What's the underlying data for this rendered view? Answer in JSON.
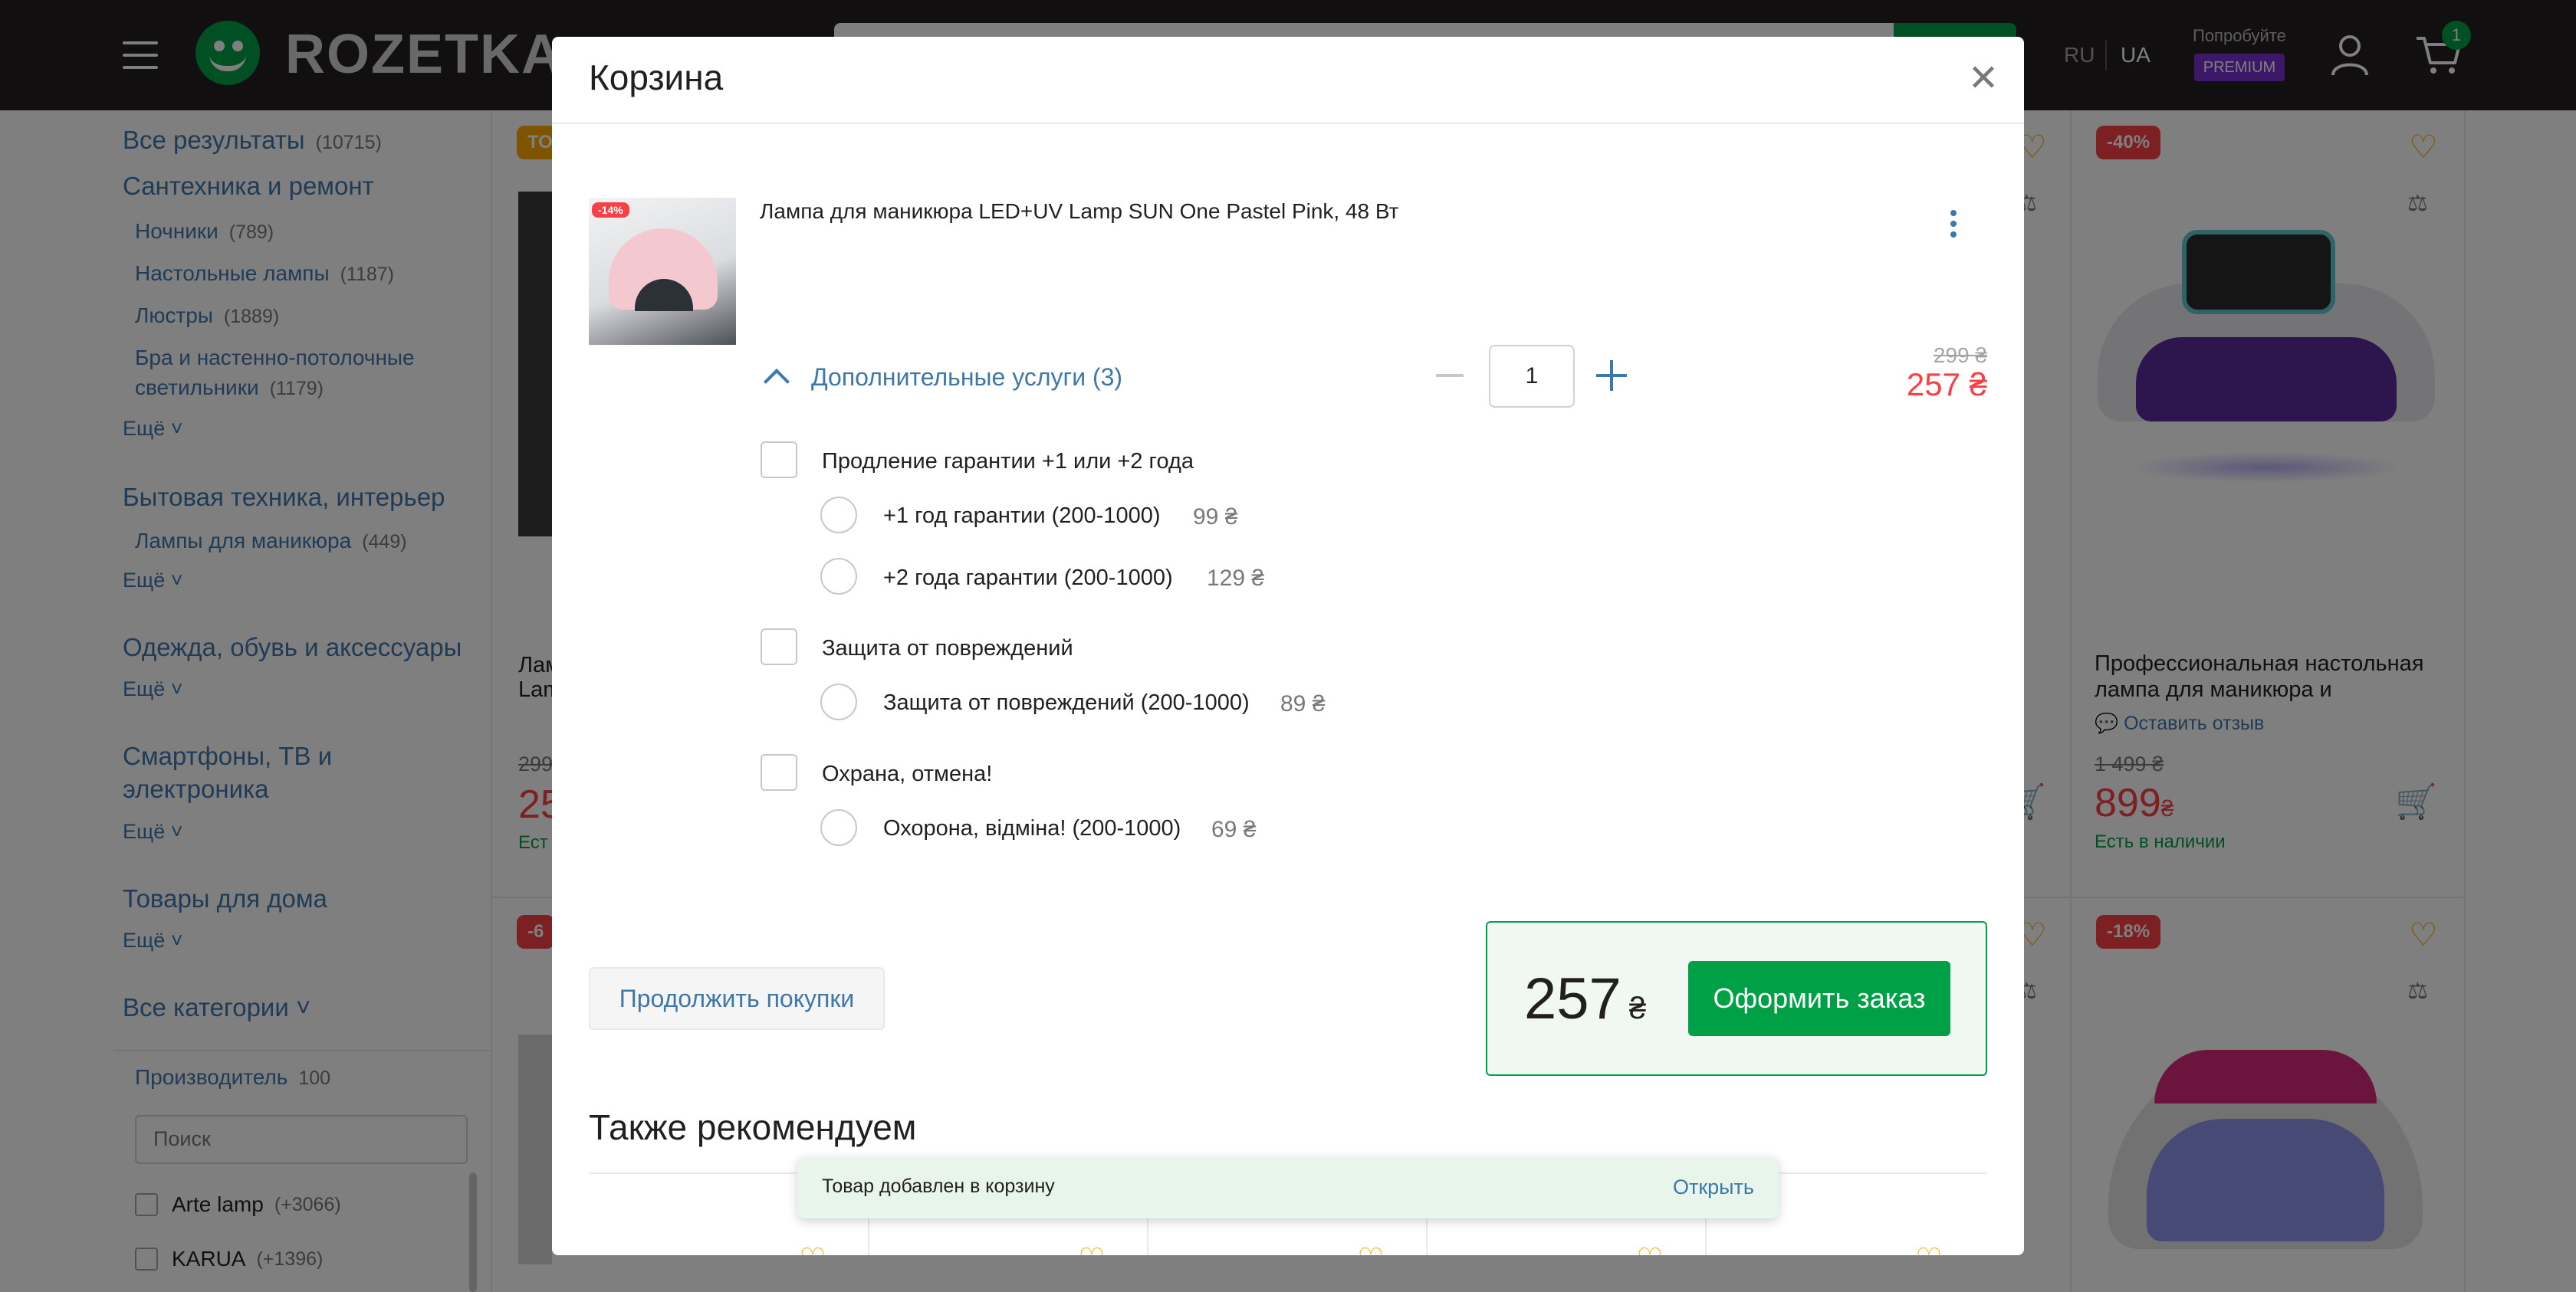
{
  "header": {
    "logo_text": "ROZETKA",
    "lang_ru": "RU",
    "lang_ua": "UA",
    "premium_title": "Попробуйте",
    "premium_badge": "PREMIUM",
    "cart_count": "1"
  },
  "sidebar": {
    "all_results": "Все результаты",
    "all_results_count": "(10715)",
    "groups": [
      {
        "title": "Сантехника и ремонт"
      },
      {
        "title": "Бытовая техника, интерьер"
      },
      {
        "title": "Одежда, обувь и аксессуары"
      },
      {
        "title": "Смартфоны, ТВ и"
      },
      {
        "title": "электроника"
      },
      {
        "title": "Товары для дома"
      }
    ],
    "subs": [
      {
        "label": "Ночники",
        "count": "(789)"
      },
      {
        "label": "Настольные лампы",
        "count": "(1187)"
      },
      {
        "label": "Люстры",
        "count": "(1889)"
      },
      {
        "label": "Бра и настенно-потолочные",
        "count": ""
      },
      {
        "label": "светильники",
        "count": "(1179)"
      },
      {
        "label": "Лампы для маникюра",
        "count": "(449)"
      }
    ],
    "more": "Ещё",
    "all_categories": "Все категории",
    "filter_title": "Производитель",
    "filter_count": "100",
    "filter_search_placeholder": "Поиск",
    "filter_items": [
      {
        "label": "Arte lamp",
        "count": "(+3066)"
      },
      {
        "label": "KARUA",
        "count": "(+1396)"
      }
    ]
  },
  "products": [
    {
      "discount": "-40%",
      "title_line1": "Профессиональная настольная",
      "title_line2": "лампа для маникюра и",
      "review": "Оставить отзыв",
      "old_price": "1 499 ₴",
      "new_price": "899",
      "currency": "₴",
      "stock": "Есть в наличии"
    },
    {
      "discount": "-18%"
    },
    {
      "partial_top_badge": "ТО",
      "partial_bottom_badge": "-6",
      "partial_title1": "Лам",
      "partial_title2": "Lam",
      "partial_old": "299",
      "partial_new": "25",
      "partial_stock": "Ест"
    }
  ],
  "cart_modal": {
    "title": "Корзина",
    "item": {
      "badge": "-14%",
      "title": "Лампа для маникюра LED+UV Lamp SUN One Pastel Pink, 48 Вт",
      "quantity": "1",
      "old_price": "299 ₴",
      "new_price": "257 ₴"
    },
    "services_toggle": "Дополнительные услуги (3)",
    "services": [
      {
        "label": "Продление гарантии +1 или +2 года",
        "options": [
          {
            "label": "+1 год гарантии (200-1000)",
            "price": "99 ₴"
          },
          {
            "label": "+2 года гарантии (200-1000)",
            "price": "129 ₴"
          }
        ]
      },
      {
        "label": "Защита от повреждений",
        "options": [
          {
            "label": "Защита от повреждений (200-1000)",
            "price": "89 ₴"
          }
        ]
      },
      {
        "label": "Охрана, отмена!",
        "options": [
          {
            "label": "Охорона, відміна! (200-1000)",
            "price": "69 ₴"
          }
        ]
      }
    ],
    "continue_label": "Продолжить покупки",
    "total": "257",
    "total_currency": "₴",
    "checkout_label": "Оформить заказ",
    "recommend_title": "Также рекомендуем"
  },
  "toast": {
    "text": "Товар добавлен в корзину",
    "link": "Открыть"
  },
  "colors": {
    "accent_green": "#00a046",
    "link_blue": "#3e77aa",
    "price_red": "#f84147",
    "favorite_orange": "#ffa900"
  }
}
